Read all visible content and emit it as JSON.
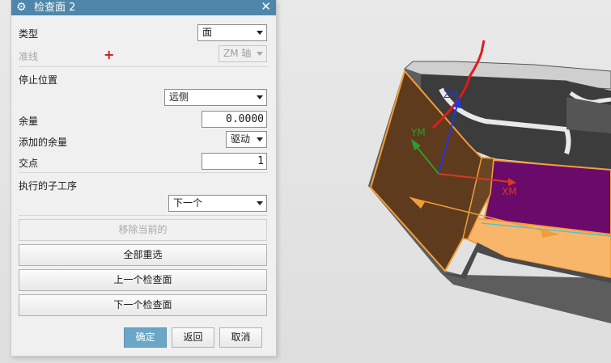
{
  "dialog": {
    "title": "检查面 2",
    "type_label": "类型",
    "type_value": "面",
    "guide_label": "准线",
    "axis_value": "ZM 轴",
    "stop_position_label": "停止位置",
    "stop_position_value": "远侧",
    "stock_label": "余量",
    "stock_value": "0.0000",
    "added_stock_label": "添加的余量",
    "added_stock_value": "驱动",
    "intersections_label": "交点",
    "intersections_value": "1",
    "sub_operation_label": "执行的子工序",
    "sub_operation_value": "下一个",
    "remove_current_label": "移除当前的",
    "reselect_all_label": "全部重选",
    "prev_check_label": "上一个检查面",
    "next_check_label": "下一个检查面",
    "ok_label": "确定",
    "back_label": "返回",
    "cancel_label": "取消"
  },
  "viewport": {
    "axes": {
      "x": "XM",
      "y": "YM",
      "z": "ZM"
    },
    "colors": {
      "selected_face": "#5e3b1c",
      "highlight_edge": "#f39d3a",
      "part_face": "#6a0a6b",
      "x_axis": "#d9391f",
      "y_axis": "#2f9b2f",
      "z_axis": "#2437d6",
      "drawn_curve": "#e21b1b"
    }
  }
}
